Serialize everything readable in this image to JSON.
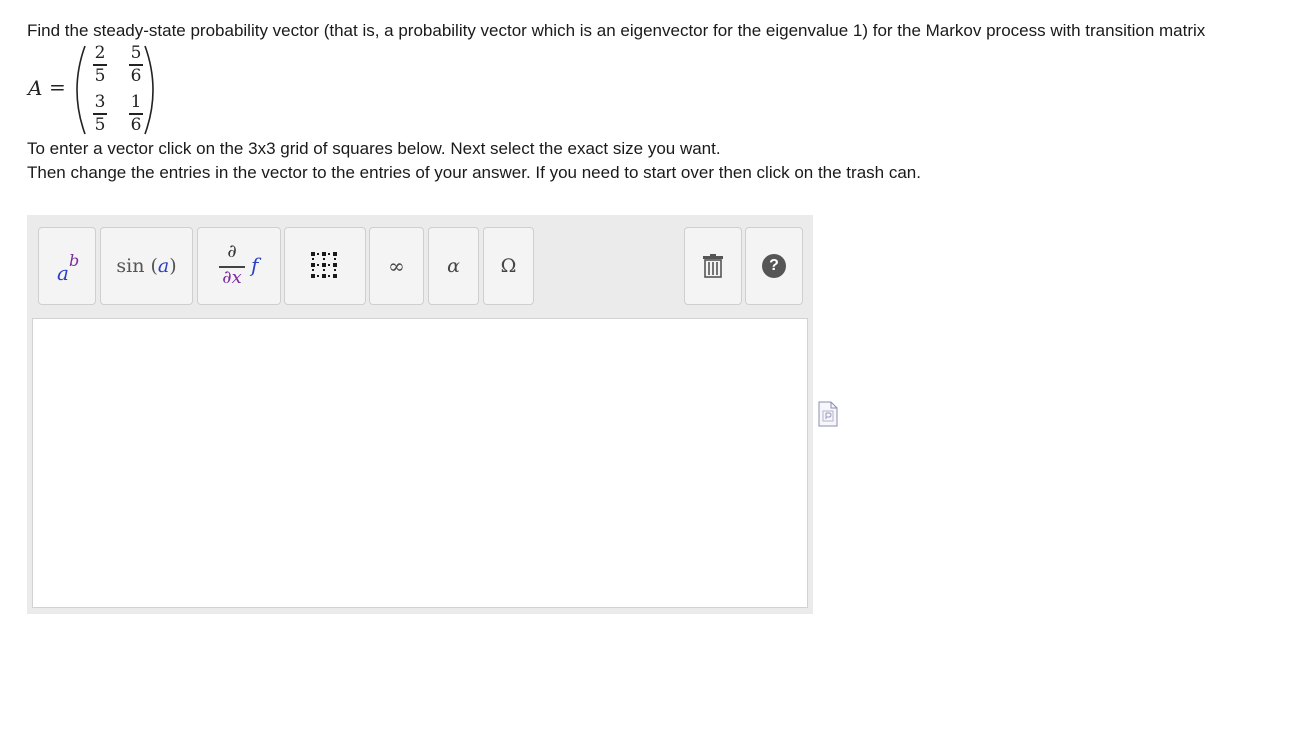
{
  "question": {
    "text": "Find the steady-state probability vector (that is, a probability vector which is an eigenvector for the eigenvalue 1) for the Markov process with transition matrix"
  },
  "matrix": {
    "label": "A",
    "equals": "=",
    "entries": [
      [
        {
          "num": "2",
          "den": "5"
        },
        {
          "num": "5",
          "den": "6"
        }
      ],
      [
        {
          "num": "3",
          "den": "5"
        },
        {
          "num": "1",
          "den": "6"
        }
      ]
    ]
  },
  "instructions": {
    "line1": "To enter a vector click on the 3x3 grid of squares below. Next select the exact size you want.",
    "line2": "Then change the entries in the vector to the entries of your answer. If you need to start over then click on the trash can."
  },
  "toolbar": {
    "power": {
      "base": "a",
      "exp": "b",
      "icon": "power-icon"
    },
    "trig": {
      "func": "sin",
      "open": "(",
      "arg": "a",
      "close": ")"
    },
    "derivative": {
      "top": "∂",
      "bottom": "∂x",
      "fn": "f",
      "icon": "derivative-icon"
    },
    "matrix_icon": "grid-icon",
    "infinity": "∞",
    "greek": "α",
    "symbols": "Ω",
    "trash_icon": "trash-icon",
    "help": "?"
  },
  "colors": {
    "power_base": "#2a3fc4",
    "power_exp": "#7b2aa0",
    "trig_arg": "#2a3fc4",
    "deriv_fn": "#2a3fc4",
    "deriv_var": "#7b2aa0",
    "help_bg": "#555555",
    "toolbar_bg": "#ebebeb"
  }
}
